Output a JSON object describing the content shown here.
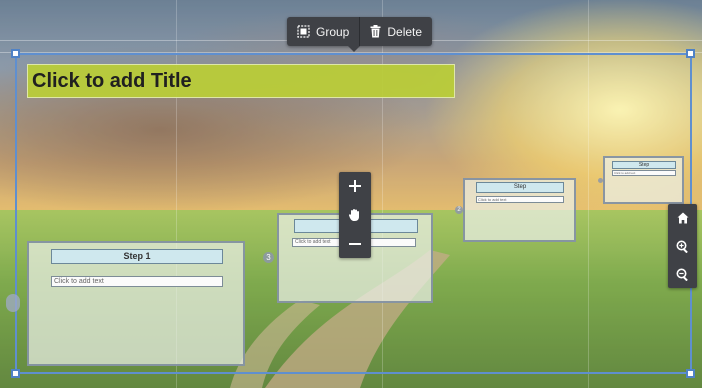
{
  "toolbar": {
    "group_label": "Group",
    "delete_label": "Delete",
    "group_icon": "group-icon",
    "delete_icon": "trash-icon"
  },
  "title": {
    "text": "Click to add Title"
  },
  "steps": [
    {
      "heading": "Step 1",
      "placeholder": "Click to add text",
      "number": ""
    },
    {
      "heading": "",
      "placeholder": "Click to add text",
      "number": "3"
    },
    {
      "heading": "Step",
      "placeholder": "Click to add text",
      "number": "2"
    },
    {
      "heading": "Step",
      "placeholder": "Click to add text",
      "number": ""
    }
  ],
  "zoom_controls": {
    "icons": [
      "plus-icon",
      "hand-icon",
      "minus-icon"
    ]
  },
  "nav_controls": {
    "icons": [
      "home-icon",
      "zoom-in-icon",
      "zoom-out-icon"
    ]
  },
  "colors": {
    "selection": "#5f8fcf",
    "title_fill": "#bacd37",
    "toolbar": "#3f4146",
    "step_heading": "#cfe8ee"
  }
}
